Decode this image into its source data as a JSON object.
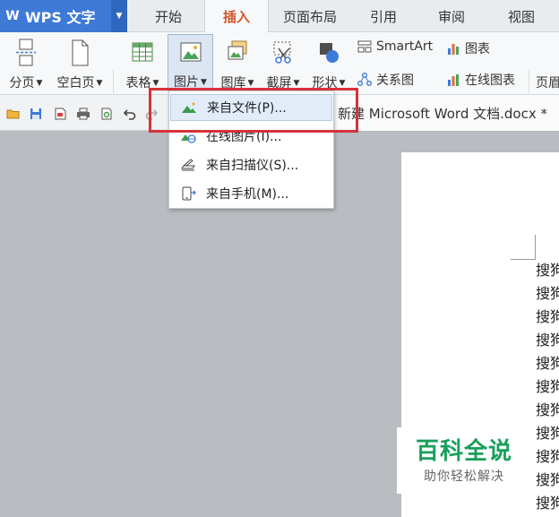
{
  "app": {
    "name": "WPS 文字",
    "logo_text": "W"
  },
  "tabs": [
    {
      "label": "开始",
      "active": false
    },
    {
      "label": "插入",
      "active": true
    },
    {
      "label": "页面布局",
      "active": false
    },
    {
      "label": "引用",
      "active": false
    },
    {
      "label": "审阅",
      "active": false
    },
    {
      "label": "视图",
      "active": false
    }
  ],
  "ribbon": {
    "page_break": "分页",
    "blank_page": "空白页",
    "table": "表格",
    "picture": "图片",
    "gallery": "图库",
    "screenshot": "截屏",
    "shapes": "形状",
    "smartart": "SmartArt",
    "chart": "图表",
    "relation": "关系图",
    "online_chart": "在线图表",
    "header_footer": "页眉"
  },
  "document": {
    "tab_title": "新建 Microsoft Word 文档.docx *"
  },
  "picture_menu": {
    "items": [
      {
        "label": "来自文件(P)...",
        "icon": "image-file-icon"
      },
      {
        "label": "在线图片(I)...",
        "icon": "online-image-icon"
      },
      {
        "label": "来自扫描仪(S)...",
        "icon": "scanner-icon"
      },
      {
        "label": "来自手机(M)...",
        "icon": "phone-icon"
      }
    ]
  },
  "page_text": {
    "lines": [
      "搜狗",
      "搜狗",
      "搜狗",
      "搜狗",
      "搜狗",
      "搜狗",
      "搜狗",
      "搜狗",
      "搜狗",
      "搜狗",
      "搜狗"
    ]
  },
  "watermark": {
    "title": "百科全说",
    "subtitle": "助你轻松解决"
  },
  "colors": {
    "accent": "#3d7ad6",
    "active_tab": "#d2562b",
    "highlight": "#d6323a",
    "watermark": "#18a05a"
  }
}
